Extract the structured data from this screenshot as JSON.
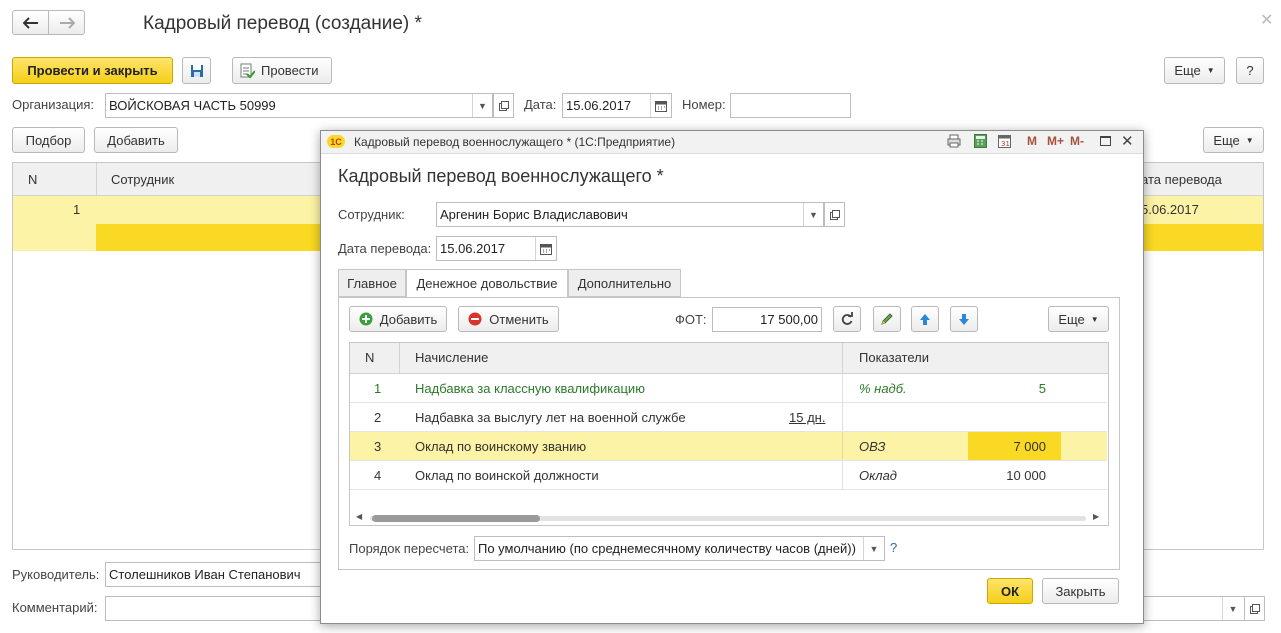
{
  "window": {
    "title": "Кадровый перевод (создание) *",
    "back_icon": "arrow-left-icon",
    "forward_icon": "arrow-right-icon",
    "close_icon": "close-icon"
  },
  "toolbar": {
    "post_close_label": "Провести и закрыть",
    "save_icon": "floppy-icon",
    "post_label": "Провести",
    "more_label": "Еще",
    "help_label": "?"
  },
  "header": {
    "org_label": "Организация:",
    "org_value": "ВОЙСКОВАЯ ЧАСТЬ 50999",
    "date_label": "Дата:",
    "date_value": "15.06.2017",
    "number_label": "Номер:",
    "number_value": ""
  },
  "table_toolbar": {
    "select_label": "Подбор",
    "add_label": "Добавить",
    "more_label": "Еще"
  },
  "main_table": {
    "columns": [
      "N",
      "Сотрудник",
      "Дата перевода"
    ],
    "visible_columns": {
      "n": "N",
      "employee": "Сотрудник",
      "date": "ата перевода"
    },
    "rows": [
      {
        "n": "1",
        "employee": "",
        "date": "5.06.2017"
      }
    ]
  },
  "footer": {
    "manager_label": "Руководитель:",
    "manager_value": "Столешников Иван Степанович",
    "comment_label": "Комментарий:",
    "comment_value": ""
  },
  "dialog": {
    "window_title": "Кадровый перевод военнослужащего * (1С:Предприятие)",
    "heading": "Кадровый перевод военнослужащего *",
    "employee_label": "Сотрудник:",
    "employee_value": "Аргенин Борис Владиславович",
    "date_label": "Дата перевода:",
    "date_value": "15.06.2017",
    "tabs": [
      "Главное",
      "Денежное довольствие",
      "Дополнительно"
    ],
    "active_tab": "Денежное довольствие",
    "add_label": "Добавить",
    "cancel_label": "Отменить",
    "fot_label": "ФОТ:",
    "fot_value": "17 500,00",
    "more_label": "Еще",
    "grid": {
      "col_n": "N",
      "col_accrual": "Начисление",
      "col_indicators": "Показатели",
      "rows": [
        {
          "n": "1",
          "accrual": "Надбавка за классную квалификацию",
          "extra": "",
          "indicator": "% надб.",
          "value": "5"
        },
        {
          "n": "2",
          "accrual": "Надбавка за выслугу лет на военной службе",
          "extra": "15 дн.",
          "indicator": "",
          "value": ""
        },
        {
          "n": "3",
          "accrual": "Оклад по воинскому званию",
          "extra": "",
          "indicator": "ОВЗ",
          "value": "7 000"
        },
        {
          "n": "4",
          "accrual": "Оклад по воинской должности",
          "extra": "",
          "indicator": "Оклад",
          "value": "10 000"
        }
      ]
    },
    "recalc_label": "Порядок пересчета:",
    "recalc_value": "По умолчанию (по среднемесячному количеству часов (дней))",
    "help_label": "?",
    "ok_label": "ОК",
    "close_label": "Закрыть",
    "titlebar_buttons": [
      "M",
      "M+",
      "M-"
    ]
  },
  "colors": {
    "accent_yellow": "#f5cf17",
    "row_highlight": "#fdf3a6",
    "cell_selected": "#f9d923",
    "green_text": "#2a7a2a"
  }
}
